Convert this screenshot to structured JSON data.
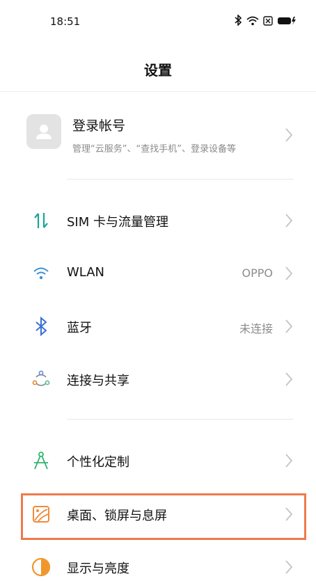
{
  "status_bar": {
    "time": "18:51",
    "icons": [
      "bluetooth-icon",
      "wifi-icon",
      "sim-off-icon",
      "battery-charging-icon"
    ]
  },
  "header": {
    "title": "设置"
  },
  "account": {
    "title": "登录帐号",
    "subtitle": "管理“云服务”、“查找手机”、登录设备等",
    "icon": "user-avatar-icon"
  },
  "settings": [
    {
      "key": "sim",
      "label": "SIM 卡与流量管理",
      "value": "",
      "icon": "sim-data-icon",
      "color": "#1aa59a"
    },
    {
      "key": "wlan",
      "label": "WLAN",
      "value": "OPPO",
      "icon": "wifi-icon",
      "color": "#3a8fd6"
    },
    {
      "key": "bluetooth",
      "label": "蓝牙",
      "value": "未连接",
      "icon": "bluetooth-icon",
      "color": "#3a6fd6"
    },
    {
      "key": "connection",
      "label": "连接与共享",
      "value": "",
      "icon": "share-nodes-icon",
      "color": "#e08a3a"
    },
    {
      "key": "personalize",
      "label": "个性化定制",
      "value": "",
      "icon": "compass-icon",
      "color": "#2fb56f"
    },
    {
      "key": "desktop",
      "label": "桌面、锁屏与息屏",
      "value": "",
      "icon": "wallpaper-icon",
      "color": "#f08a3a"
    },
    {
      "key": "display",
      "label": "显示与亮度",
      "value": "",
      "icon": "brightness-icon",
      "color": "#f0962a"
    }
  ],
  "highlight_color": "#ef7a4a"
}
